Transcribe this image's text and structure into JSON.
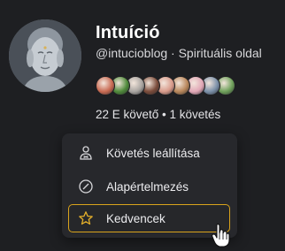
{
  "profile": {
    "name": "Intuíció",
    "handle_line": "@intucioblog · Spirituális oldal",
    "stats": "22 E követő • 1 követés"
  },
  "followers_preview": {
    "count_shown": 9,
    "colors": [
      "#c96a52",
      "#4f8a3a",
      "#a8a4a0",
      "#7a4b3a",
      "#d89a8a",
      "#b8865a",
      "#e1a7b6",
      "#7a8fa8",
      "#6ea05a"
    ]
  },
  "menu": {
    "items": [
      {
        "label": "Követés leállítása",
        "icon": "unfollow-person-icon"
      },
      {
        "label": "Alapértelmezés",
        "icon": "default-circle-icon"
      },
      {
        "label": "Kedvencek",
        "icon": "star-icon",
        "active": true
      }
    ]
  },
  "colors": {
    "background": "#1e1f22",
    "menu_background": "#27282c",
    "active_border": "#d9a31c"
  }
}
